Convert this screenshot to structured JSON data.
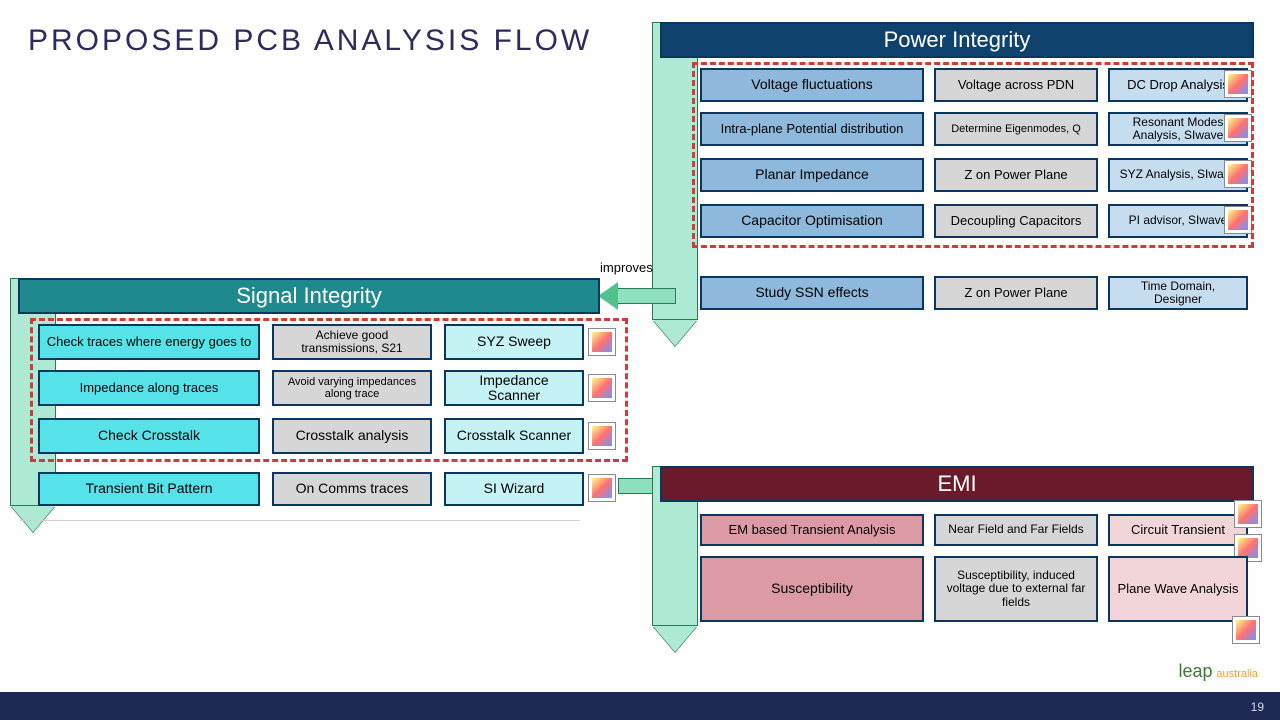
{
  "title": "PROPOSED PCB ANALYSIS FLOW",
  "improvesLabel": "improves",
  "pageNumber": "19",
  "leapBrand": "leap",
  "leapSuffix": "australia",
  "pi": {
    "header": "Power Integrity",
    "rows": [
      {
        "topic": "Voltage fluctuations",
        "mid": "Voltage across PDN",
        "tool": "DC Drop Analysis"
      },
      {
        "topic": "Intra-plane  Potential distribution",
        "mid": "Determine Eigenmodes, Q",
        "tool": "Resonant Modes Analysis, SIwave"
      },
      {
        "topic": "Planar Impedance",
        "mid": "Z on Power Plane",
        "tool": "SYZ Analysis, SIwave"
      },
      {
        "topic": "Capacitor Optimisation",
        "mid": "Decoupling Capacitors",
        "tool": "PI advisor, SIwave"
      },
      {
        "topic": "Study SSN effects",
        "mid": "Z on Power Plane",
        "tool": "Time Domain, Designer"
      }
    ]
  },
  "si": {
    "header": "Signal Integrity",
    "rows": [
      {
        "topic": "Check traces where energy goes to",
        "mid": "Achieve good transmissions, S21",
        "tool": "SYZ Sweep"
      },
      {
        "topic": "Impedance along traces",
        "mid": "Avoid varying impedances along trace",
        "tool": "Impedance Scanner"
      },
      {
        "topic": "Check Crosstalk",
        "mid": "Crosstalk analysis",
        "tool": "Crosstalk Scanner"
      },
      {
        "topic": "Transient Bit Pattern",
        "mid": "On Comms traces",
        "tool": "SI Wizard"
      }
    ]
  },
  "emi": {
    "header": "EMI",
    "rows": [
      {
        "topic": "EM based Transient Analysis",
        "mid": "Near Field and Far Fields",
        "tool": "Circuit Transient"
      },
      {
        "topic": "Susceptibility",
        "mid": "Susceptibility, induced voltage due to external far fields",
        "tool": "Plane Wave Analysis"
      }
    ]
  }
}
